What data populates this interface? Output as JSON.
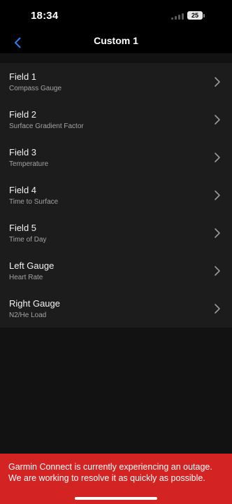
{
  "status_bar": {
    "time": "18:34",
    "battery_level": "25"
  },
  "header": {
    "title": "Custom 1",
    "back_icon": "chevron-left-icon"
  },
  "fields": [
    {
      "label": "Field 1",
      "value": "Compass Gauge"
    },
    {
      "label": "Field 2",
      "value": "Surface Gradient Factor"
    },
    {
      "label": "Field 3",
      "value": "Temperature"
    },
    {
      "label": "Field 4",
      "value": "Time to Surface"
    },
    {
      "label": "Field 5",
      "value": "Time of Day"
    },
    {
      "label": "Left Gauge",
      "value": "Heart Rate"
    },
    {
      "label": "Right Gauge",
      "value": "N2/He Load"
    }
  ],
  "banner": {
    "message": "Garmin Connect is currently experiencing an outage. We are working to resolve it as quickly as possible."
  },
  "colors": {
    "accent": "#2f7ff0",
    "banner_background": "#d42323"
  }
}
